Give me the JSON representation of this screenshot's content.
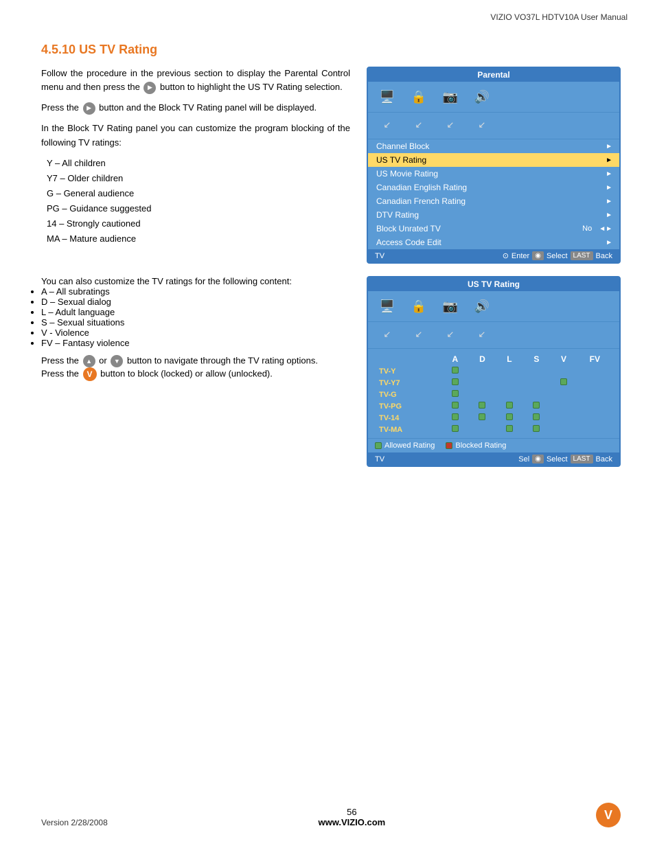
{
  "header": {
    "title": "VIZIO VO37L HDTV10A User Manual"
  },
  "section": {
    "number": "4.5.10",
    "title": "US TV Rating",
    "intro1": "Follow the procedure in the previous section to display the Parental Control menu and then press the",
    "intro_mid": "button to highlight the US TV Rating selection.",
    "intro2": "Press the",
    "intro_mid2": "button and the Block TV Rating panel will be displayed.",
    "body1": "In the Block TV Rating panel you can customize the program blocking of the following TV ratings:",
    "ratings": [
      "Y – All children",
      "Y7 – Older children",
      "G – General audience",
      "PG – Guidance suggested",
      "14 – Strongly cautioned",
      "MA – Mature audience"
    ],
    "body2": "You can also customize the TV ratings for the following content:",
    "content_ratings": [
      "A – All subratings",
      "D – Sexual dialog",
      "L – Adult language",
      "S – Sexual situations",
      "V - Violence",
      "FV – Fantasy violence"
    ],
    "body3": "Press the",
    "body3_mid": "or",
    "body3_end": "button to navigate through the TV rating options.",
    "body4": "Press the",
    "body4_end": "button to block (locked) or allow (unlocked)."
  },
  "parental_panel": {
    "title": "Parental",
    "menu_items": [
      {
        "label": "Channel Block",
        "value": "",
        "arrow": "►",
        "highlighted": false
      },
      {
        "label": "US TV Rating",
        "value": "",
        "arrow": "►",
        "highlighted": true
      },
      {
        "label": "US Movie Rating",
        "value": "",
        "arrow": "►",
        "highlighted": false
      },
      {
        "label": "Canadian English Rating",
        "value": "",
        "arrow": "►",
        "highlighted": false
      },
      {
        "label": "Canadian French Rating",
        "value": "",
        "arrow": "►",
        "highlighted": false
      },
      {
        "label": "DTV Rating",
        "value": "",
        "arrow": "►",
        "highlighted": false
      },
      {
        "label": "Block Unrated TV",
        "value": "No",
        "arrow": "◄►",
        "highlighted": false
      },
      {
        "label": "Access Code Edit",
        "value": "",
        "arrow": "►",
        "highlighted": false
      }
    ],
    "footer_left": "TV",
    "footer_controls": "Enter ◉ Select LAST Back"
  },
  "tv_rating_panel": {
    "title": "US TV Rating",
    "columns": [
      "A",
      "D",
      "L",
      "S",
      "V",
      "FV"
    ],
    "rows": [
      {
        "label": "TV-Y",
        "cells": [
          true,
          false,
          false,
          false,
          false,
          false
        ]
      },
      {
        "label": "TV-Y7",
        "cells": [
          false,
          false,
          false,
          false,
          true,
          false
        ]
      },
      {
        "label": "TV-G",
        "cells": [
          true,
          false,
          false,
          false,
          false,
          false
        ]
      },
      {
        "label": "TV-PG",
        "cells": [
          true,
          true,
          true,
          true,
          false,
          false
        ]
      },
      {
        "label": "TV-14",
        "cells": [
          true,
          true,
          true,
          true,
          false,
          false
        ]
      },
      {
        "label": "TV-MA",
        "cells": [
          true,
          false,
          true,
          true,
          false,
          false
        ]
      }
    ],
    "legend_allowed": "Allowed Rating",
    "legend_blocked": "Blocked Rating",
    "footer_left": "TV",
    "footer_controls": "Sel ◉ Select LAST Back"
  },
  "footer": {
    "version": "Version 2/28/2008",
    "page": "56",
    "website": "www.VIZIO.com",
    "logo": "V"
  }
}
